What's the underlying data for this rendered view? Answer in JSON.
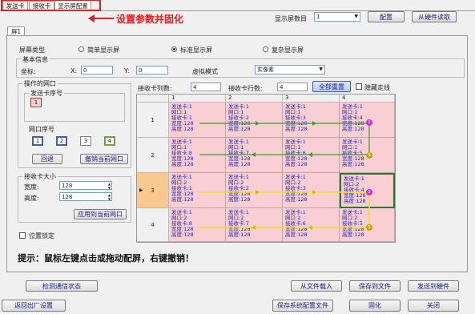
{
  "tabs": [
    {
      "label": "发送卡"
    },
    {
      "label": "接收卡"
    },
    {
      "label": "显示屏配置"
    }
  ],
  "annotation": {
    "text": "设置参数并固化",
    "color": "#e02020"
  },
  "top": {
    "screen_count_label": "显示屏数目",
    "screen_count_value": "1",
    "config_button": "配置",
    "read_hw_button": "从硬件读取"
  },
  "screen_tab": "屏1",
  "screen_type": {
    "label": "屏幕类型",
    "options": [
      "简单显示屏",
      "标准显示屏",
      "复杂显示屏"
    ],
    "selected": 1
  },
  "basic_info": {
    "title": "基本信息",
    "coord_label": "坐标:",
    "x_label": "X:",
    "x_value": "0",
    "y_label": "Y:",
    "y_value": "0",
    "virtual_label": "虚拟模式",
    "virtual_value": "实像素"
  },
  "operation_port": {
    "title": "操作的网口",
    "sender_title": "发送卡序号",
    "sender_value": "1",
    "port_title": "网口序号",
    "ports": [
      "1",
      "2",
      "3",
      "4"
    ],
    "back_button": "回退",
    "cancel_button": "撤销当前网口"
  },
  "receiver_size": {
    "title": "接收卡大小",
    "width_label": "宽度:",
    "width_value": "128",
    "height_label": "高度:",
    "height_value": "128",
    "apply_button": "应用到当前网口"
  },
  "grid_controls": {
    "cols_label": "接收卡列数:",
    "cols_value": "4",
    "rows_label": "接收卡行数:",
    "rows_value": "4",
    "clear_button": "全部重置",
    "hide_route_label": "隐藏走线"
  },
  "lock_label": "位置锁定",
  "grid": {
    "col_headers": [
      "1",
      "2",
      "3",
      "4"
    ],
    "row_headers": [
      "1",
      "2",
      "3",
      "4"
    ],
    "cells": [
      [
        [
          "发送卡:1",
          "网口:1",
          "接收卡:1",
          "宽度:128",
          "高度:128"
        ],
        [
          "发送卡:1",
          "网口:1",
          "接收卡:2",
          "宽度:128",
          "高度:128"
        ],
        [
          "发送卡:1",
          "网口:1",
          "接收卡:3",
          "宽度:128",
          "高度:128"
        ],
        [
          "发送卡:1",
          "网口:1",
          "接收卡:4",
          "宽度:128",
          "高度:128"
        ]
      ],
      [
        [
          "发送卡:1",
          "网口:1",
          "接收卡:8",
          "宽度:128",
          "高度:128"
        ],
        [
          "发送卡:1",
          "网口:1",
          "接收卡:7",
          "宽度:128",
          "高度:128"
        ],
        [
          "发送卡:1",
          "网口:1",
          "接收卡:6",
          "宽度:128",
          "高度:128"
        ],
        [
          "发送卡:1",
          "网口:1",
          "接收卡:5",
          "宽度:128",
          "高度:128"
        ]
      ],
      [
        [
          "发送卡:1",
          "网口:2",
          "接收卡:1",
          "宽度:128",
          "高度:128"
        ],
        [
          "发送卡:1",
          "网口:2",
          "接收卡:2",
          "宽度:128",
          "高度:128"
        ],
        [
          "发送卡:1",
          "网口:2",
          "接收卡:3",
          "宽度:128",
          "高度:128"
        ],
        [
          "发送卡:1",
          "网口:2",
          "接收卡:4",
          "宽度:128",
          "高度:128"
        ]
      ],
      [
        [
          "发送卡:1",
          "网口:2",
          "接收卡:8",
          "宽度:128",
          "高度:128"
        ],
        [
          "发送卡:1",
          "网口:2",
          "接收卡:7",
          "宽度:128",
          "高度:128"
        ],
        [
          "发送卡:1",
          "网口:2",
          "接收卡:6",
          "宽度:128",
          "高度:128"
        ],
        [
          "发送卡:1",
          "网口:2",
          "接收卡:5",
          "宽度:128",
          "高度:128"
        ]
      ]
    ],
    "route_colors": {
      "port1": "#33a033",
      "port2": "#f0e020",
      "badge_start": "#d030d0",
      "badge_end": "#d0a000"
    }
  },
  "hint": "提示：鼠标左键点击或拖动配屏，右键撤销！",
  "bottom": {
    "detect_button": "检测通信状态",
    "load_button": "从文件载入",
    "save_button": "保存到文件",
    "send_button": "发送到硬件",
    "factory_button": "返回出厂设置",
    "save_config_button": "保存系统配置文件",
    "solidify_button": "固化",
    "close_button": "关闭"
  }
}
